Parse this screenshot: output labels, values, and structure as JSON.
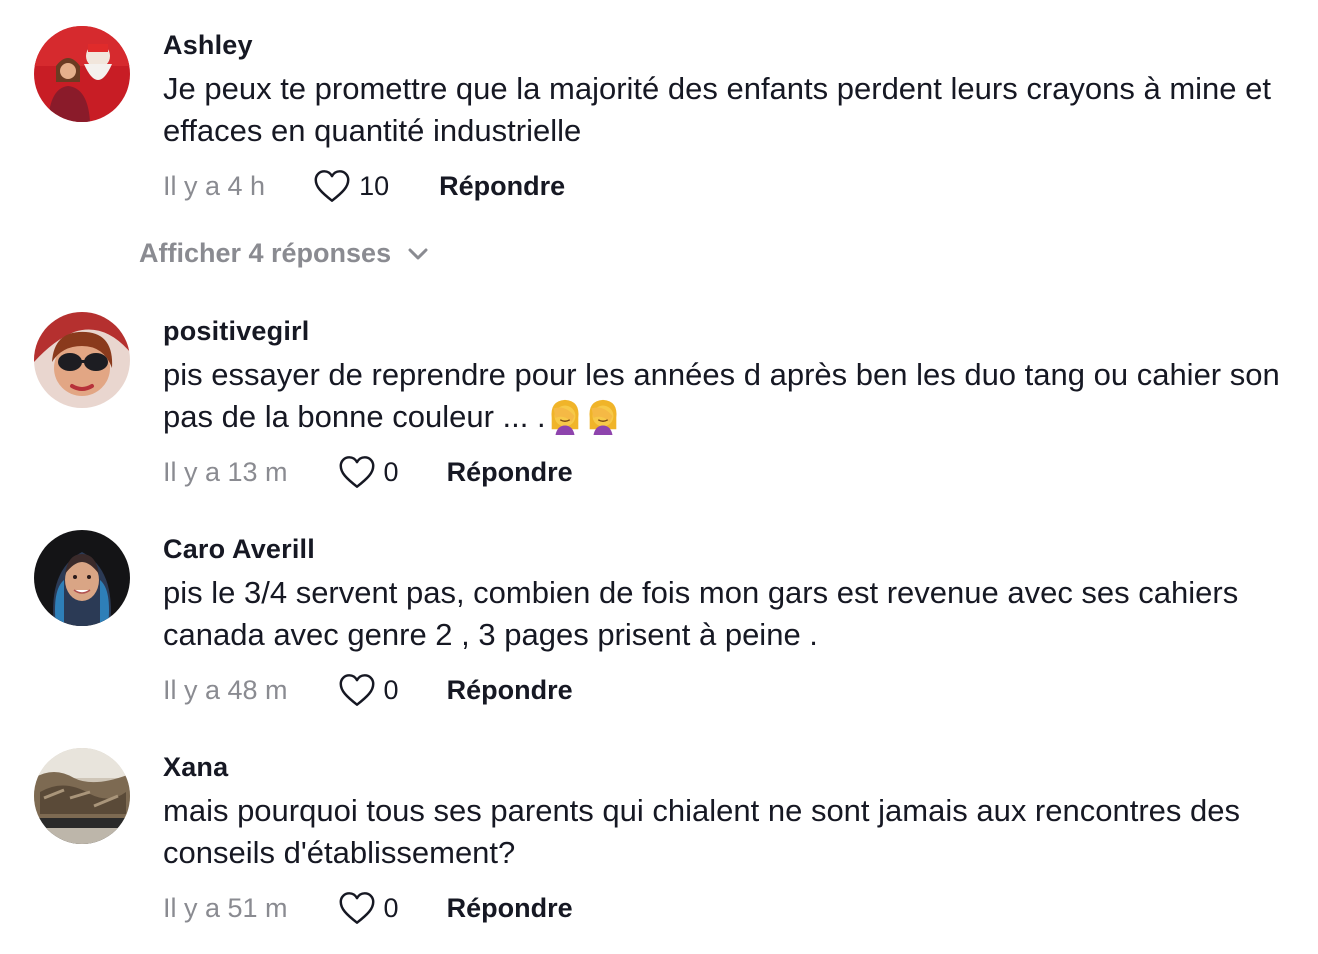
{
  "comments": [
    {
      "username": "Ashley",
      "text": "Je peux te promettre que la majorité des enfants perdent leurs crayons à mine et effaces en quantité industrielle",
      "time": "Il y a 4 h",
      "likes": "10",
      "reply_label": "Répondre",
      "show_replies": "Afficher 4 réponses"
    },
    {
      "username": "positivegirl",
      "text": "pis essayer de reprendre pour les années d après ben les duo tang ou cahier son pas de la bonne couleur ... .",
      "emoji": [
        "woman-facepalming-emoji",
        "woman-facepalming-emoji"
      ],
      "time": "Il y a 13 m",
      "likes": "0",
      "reply_label": "Répondre"
    },
    {
      "username": "Caro Averill",
      "text": "pis le 3/4 servent pas, combien de fois mon gars est revenue avec ses cahiers canada avec genre 2 , 3 pages prisent à peine .",
      "time": "Il y a 48 m",
      "likes": "0",
      "reply_label": "Répondre"
    },
    {
      "username": "Xana",
      "text": "mais pourquoi tous ses parents qui chialent ne sont jamais aux rencontres des conseils d'établissement?",
      "time": "Il y a 51 m",
      "likes": "0",
      "reply_label": "Répondre"
    }
  ],
  "icons": {
    "like": "heart-outline-icon",
    "expand": "chevron-down-icon"
  },
  "colors": {
    "text": "#161823",
    "muted": "#8a8b91"
  }
}
